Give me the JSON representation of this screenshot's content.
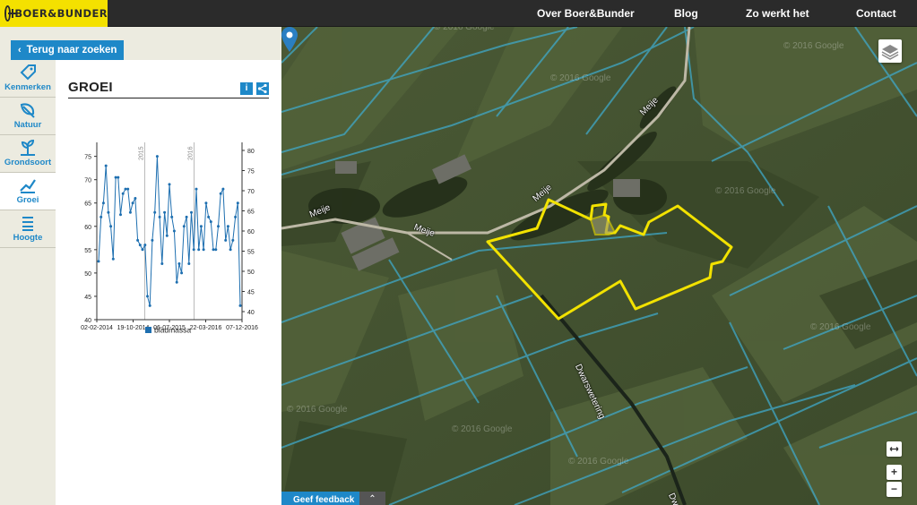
{
  "brand": {
    "name": "BOER&BUNDER"
  },
  "topnav": [
    {
      "label": "Over Boer&Bunder"
    },
    {
      "label": "Blog"
    },
    {
      "label": "Zo werkt het"
    },
    {
      "label": "Contact"
    }
  ],
  "back_button": {
    "label": "Terug naar zoeken"
  },
  "sidebar": {
    "items": [
      {
        "label": "Kenmerken",
        "icon": "tag-icon"
      },
      {
        "label": "Natuur",
        "icon": "leaf-icon"
      },
      {
        "label": "Grondsoort",
        "icon": "plant-icon"
      },
      {
        "label": "Groei",
        "icon": "growth-line-icon"
      },
      {
        "label": "Hoogte",
        "icon": "bars-icon"
      }
    ],
    "active": "Groei"
  },
  "panel": {
    "title": "GROEI",
    "info_icon": "info-icon",
    "share_icon": "share-icon"
  },
  "chart_data": {
    "type": "line",
    "title": "",
    "x_tick_labels": [
      "02-02-2014",
      "19-10-2014",
      "06-07-2015",
      "22-03-2016",
      "07-12-2016"
    ],
    "year_markers": [
      "2015",
      "2016"
    ],
    "left_axis": {
      "ticks": [
        40,
        45,
        50,
        55,
        60,
        65,
        70,
        75
      ],
      "range": [
        40,
        78
      ]
    },
    "right_axis": {
      "ticks": [
        40,
        45,
        50,
        55,
        60,
        65,
        70,
        75,
        80
      ],
      "range": [
        38,
        82
      ]
    },
    "series": [
      {
        "name": "bladmassa",
        "color": "#1e6fb0",
        "values": [
          52.5,
          62,
          65,
          73,
          63,
          60,
          53,
          70.5,
          70.5,
          62.5,
          67,
          68,
          68,
          63,
          65,
          66,
          57,
          56,
          55,
          56,
          45,
          43,
          57,
          63,
          75,
          62,
          52,
          63,
          58,
          69,
          62,
          59,
          48,
          52,
          50,
          60,
          62,
          52,
          63,
          55,
          68,
          55,
          60,
          55,
          65,
          62,
          61,
          55,
          55,
          60,
          67,
          68,
          57,
          60,
          55,
          57,
          62,
          65,
          43
        ]
      }
    ],
    "legend_position": "bottom",
    "grid": false
  },
  "map": {
    "road_labels": [
      "Meije",
      "Meije",
      "Meije",
      "Meije",
      "Dwarswetering",
      "Dwarsw"
    ],
    "watermark": "© 2016 Google",
    "layers_icon": "layers-icon",
    "zoom_in_label": "+",
    "zoom_out_label": "−",
    "fullscreen_icon": "fullscreen-icon"
  },
  "feedback": {
    "label": "Geef feedback",
    "collapse_icon": "chevron-up-icon"
  }
}
